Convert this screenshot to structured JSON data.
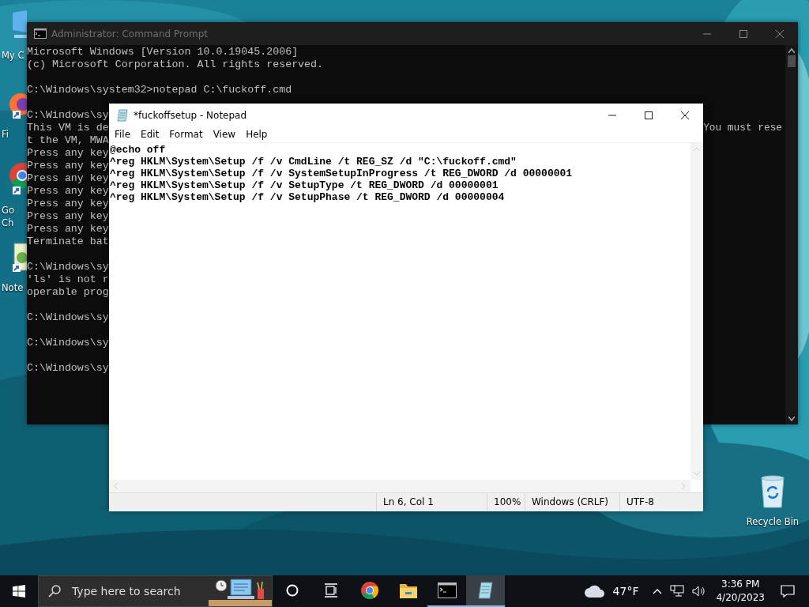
{
  "desktop": {
    "icons": [
      {
        "kind": "computer",
        "label": "My C"
      },
      {
        "kind": "firefox",
        "label": "Fi"
      },
      {
        "kind": "chrome",
        "label": "Go Ch"
      },
      {
        "kind": "notepad",
        "label": "Note"
      },
      {
        "kind": "recycle",
        "label": "Recycle Bin"
      }
    ]
  },
  "cmd_window": {
    "title": "Administrator: Command Prompt",
    "active": false,
    "blocks": [
      [
        {
          "text": "Microsoft Windows [Version 10.0.19045.2006]"
        },
        {
          "text": "(c) Microsoft Corporation. All rights reserved."
        }
      ],
      [
        {
          "text": "C:\\Windows\\system32>notepad C:\\fuckoff.cmd"
        }
      ],
      [
        {
          "text": "C:\\Windows\\sy"
        },
        {
          "text": "This VM is de",
          "tail": "You must rese"
        },
        {
          "text": "t the VM, MWA"
        },
        {
          "text": "Press any key"
        },
        {
          "text": "Press any key"
        },
        {
          "text": "Press any key"
        },
        {
          "text": "Press any key"
        },
        {
          "text": "Press any key"
        },
        {
          "text": "Press any key"
        },
        {
          "text": "Press any key"
        },
        {
          "text": "Terminate bat"
        }
      ],
      [
        {
          "text": "C:\\Windows\\sy"
        },
        {
          "text": "'ls' is not r"
        },
        {
          "text": "operable prog"
        }
      ],
      [
        {
          "text": "C:\\Windows\\sy"
        }
      ],
      [
        {
          "text": "C:\\Windows\\sy"
        }
      ],
      [
        {
          "text": "C:\\Windows\\sy"
        }
      ]
    ]
  },
  "notepad_window": {
    "title": "*fuckoffsetup - Notepad",
    "active": true,
    "menu": [
      "File",
      "Edit",
      "Format",
      "View",
      "Help"
    ],
    "lines": [
      "@echo off",
      "^reg HKLM\\System\\Setup /f /v CmdLine /t REG_SZ /d \"C:\\fuckoff.cmd\"",
      "^reg HKLM\\System\\Setup /f /v SystemSetupInProgress /t REG_DWORD /d 00000001",
      "^reg HKLM\\System\\Setup /f /v SetupType /t REG_DWORD /d 00000001",
      "^reg HKLM\\System\\Setup /f /v SetupPhase /t REG_DWORD /d 00000004"
    ],
    "status_bar": [
      "Ln 6, Col 1",
      "100%",
      "Windows (CRLF)",
      "UTF-8"
    ]
  },
  "taskbar": {
    "search": {
      "placeholder": "Type here to search"
    },
    "apps": [
      {
        "kind": "cortana",
        "running": false,
        "selected": false
      },
      {
        "kind": "taskview",
        "running": false,
        "selected": false
      },
      {
        "kind": "chrome",
        "running": false,
        "selected": false
      },
      {
        "kind": "explorer",
        "running": false,
        "selected": false
      },
      {
        "kind": "cmd",
        "running": true,
        "selected": false
      },
      {
        "kind": "notepad",
        "running": true,
        "selected": true
      }
    ],
    "weather": "47°F",
    "time": "3:36 PM",
    "date": "4/20/2023"
  }
}
